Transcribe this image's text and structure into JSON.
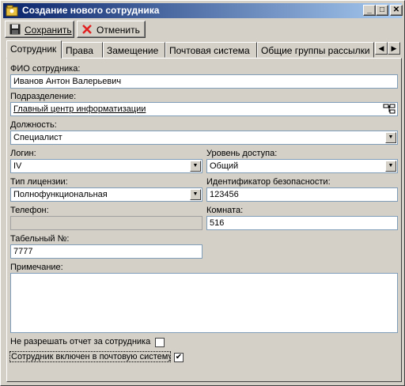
{
  "window": {
    "title": "Создание нового сотрудника"
  },
  "toolbar": {
    "save_label": "Сохранить",
    "cancel_label": "Отменить"
  },
  "tabs": [
    "Сотрудник",
    "Права",
    "Замещение",
    "Почтовая система",
    "Общие группы рассылки"
  ],
  "form": {
    "fio_label": "ФИО сотрудника:",
    "fio_value": "Иванов Антон Валерьевич",
    "dept_label": "Подразделение:",
    "dept_value": "Главный центр информатизации",
    "position_label": "Должность:",
    "position_value": "Специалист",
    "login_label": "Логин:",
    "login_value": "IV",
    "access_label": "Уровень доступа:",
    "access_value": "Общий",
    "license_label": "Тип лицензии:",
    "license_value": "Полнофункциональная",
    "security_id_label": "Идентификатор безопасности:",
    "security_id_value": "123456",
    "phone_label": "Телефон:",
    "phone_value": "",
    "room_label": "Комната:",
    "room_value": "516",
    "tabnum_label": "Табельный №:",
    "tabnum_value": "7777",
    "note_label": "Примечание:",
    "note_value": "",
    "no_report_label": "Не разрешать отчет за сотрудника",
    "no_report_checked": false,
    "mail_label": "Сотрудник включен в почтовую систему",
    "mail_checked": true
  },
  "colors": {
    "title_start": "#0a246a",
    "title_end": "#a6caf0",
    "face": "#d4d0c8"
  }
}
